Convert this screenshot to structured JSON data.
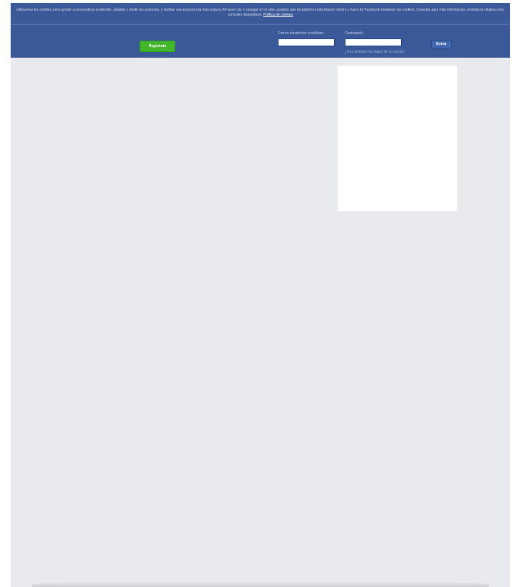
{
  "cookie_banner": {
    "text": "Utilizamos las cookies para ayudar a personalizar contenido, adaptar y medir los anuncios, y facilitar una experiencia más segura. Al hacer clic o navegar en el sitio, aceptas que recopilemos información dentro y fuera de Facebook mediante las cookies. Consulta aquí más información, incluida la relativa a los controles disponibles:",
    "policy_link": "Política de cookies"
  },
  "header": {
    "register_label": "Regístrate",
    "email_label": "Correo electrónico o teléfono",
    "password_label": "Contraseña",
    "login_label": "Entrar",
    "forgot_label": "¿Has olvidado los datos de la cuenta?",
    "email_value": "",
    "password_value": ""
  },
  "colors": {
    "header_bg": "#3b5998",
    "page_bg": "#e9eaee",
    "register_green": "#42b72a"
  }
}
